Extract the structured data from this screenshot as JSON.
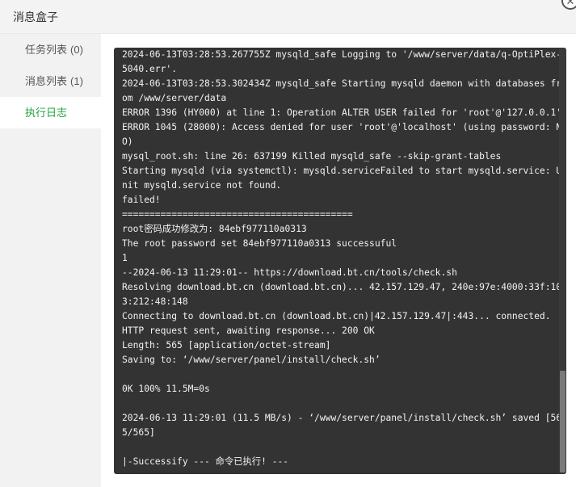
{
  "window": {
    "title": "消息盒子",
    "close_symbol": "✕"
  },
  "sidebar": {
    "items": [
      {
        "label": "任务列表",
        "count": "(0)"
      },
      {
        "label": "消息列表",
        "count": "(1)"
      },
      {
        "label": "执行日志",
        "count": ""
      }
    ],
    "active_index": 2
  },
  "log": {
    "lines": [
      "2024-06-13T03:28:53.267755Z mysqld_safe Logging to '/www/server/data/q-OptiPlex-",
      "5040.err'.",
      "2024-06-13T03:28:53.302434Z mysqld_safe Starting mysqld daemon with databases fr",
      "om /www/server/data",
      "ERROR 1396 (HY000) at line 1: Operation ALTER USER failed for 'root'@'127.0.0.1'",
      "ERROR 1045 (28000): Access denied for user 'root'@'localhost' (using password: N",
      "O)",
      "mysql_root.sh: line 26: 637199 Killed mysqld_safe --skip-grant-tables",
      "Starting mysqld (via systemctl): mysqld.serviceFailed to start mysqld.service: U",
      "nit mysqld.service not found.",
      "failed!",
      "==========================================",
      "root密码成功修改为: 84ebf977110a0313",
      "The root password set 84ebf977110a0313 successuful",
      "1",
      "--2024-06-13 11:29:01-- https://download.bt.cn/tools/check.sh",
      "Resolving download.bt.cn (download.bt.cn)... 42.157.129.47, 240e:97e:4000:33f:10",
      "3:212:48:148",
      "Connecting to download.bt.cn (download.bt.cn)|42.157.129.47|:443... connected.",
      "HTTP request sent, awaiting response... 200 OK",
      "Length: 565 [application/octet-stream]",
      "Saving to: ‘/www/server/panel/install/check.sh’",
      "",
      "0K 100% 11.5M=0s",
      "",
      "2024-06-13 11:29:01 (11.5 MB/s) - ‘/www/server/panel/install/check.sh’ saved [56",
      "5/565]",
      "",
      "|-Successify --- 命令已执行! ---"
    ],
    "scroll_position": 0.76
  },
  "colors": {
    "accent": "#20a53a",
    "terminal_bg": "#333333",
    "terminal_text": "#f2f2f2",
    "sidebar_bg": "#f2f2f2"
  }
}
